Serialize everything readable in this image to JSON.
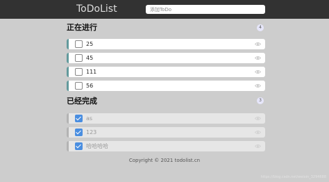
{
  "app": {
    "title": "ToDoList",
    "search_placeholder": "添加ToDo"
  },
  "sections": {
    "in_progress": {
      "title": "正在进行",
      "count": "4",
      "items": [
        {
          "label": "25",
          "checked": false
        },
        {
          "label": "45",
          "checked": false
        },
        {
          "label": "111",
          "checked": false
        },
        {
          "label": "56",
          "checked": false
        }
      ]
    },
    "done": {
      "title": "已经完成",
      "count": "3",
      "items": [
        {
          "label": "as",
          "checked": true
        },
        {
          "label": "123",
          "checked": true
        },
        {
          "label": "哈哈哈哈",
          "checked": true
        }
      ]
    }
  },
  "footer": {
    "copyright": "Copyright © 2021 todolist.cn"
  },
  "watermark": "https://blog.csdn.net/weixin_3294688",
  "colors": {
    "header_bg": "#323232",
    "page_bg": "#cdcdcd",
    "todo_accent": "#629a9c",
    "done_accent": "#b3b3b3",
    "checkbox_checked": "#4a8ee0"
  },
  "icons": {
    "item_action": "eye-icon"
  }
}
